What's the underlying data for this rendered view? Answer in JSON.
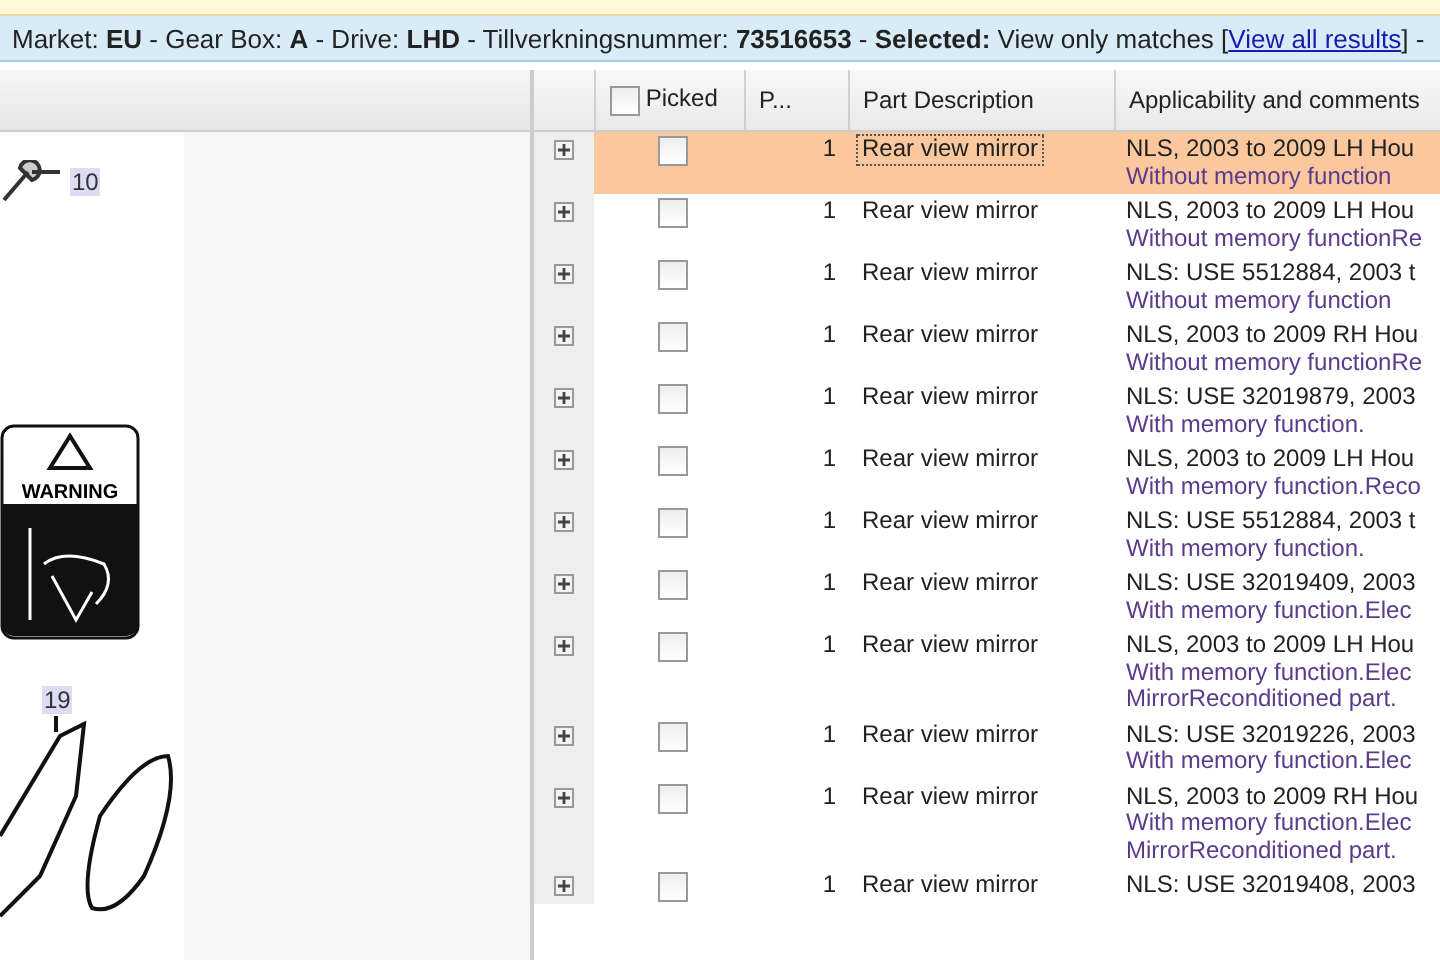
{
  "info_bar": {
    "text": "Market: **EU** - Gear Box: **A** - Drive: **LHD** - Tillverkningsnummer: **73516653** - **Selected:** View only matches [",
    "link": "View all results",
    "tail": "] -"
  },
  "diagram": {
    "callouts": [
      "10",
      "19"
    ],
    "warning_label": "WARNING"
  },
  "table": {
    "header_checkbox": {
      "checked": false
    },
    "columns": [
      "Picked",
      "P...",
      "Part Description",
      "Applicability and comments"
    ],
    "rows": [
      {
        "selected": true,
        "expanded": false,
        "checked": false,
        "qty": "1",
        "description": "Rear view mirror",
        "comments": [
          "NLS, 2003 to 2009 LH Hou",
          "Without memory function"
        ]
      },
      {
        "selected": false,
        "expanded": false,
        "checked": false,
        "qty": "1",
        "description": "Rear view mirror",
        "comments": [
          "NLS, 2003 to 2009 LH Hou",
          "Without memory functionRe"
        ]
      },
      {
        "selected": false,
        "expanded": false,
        "checked": false,
        "qty": "1",
        "description": "Rear view mirror",
        "comments": [
          "NLS: USE 5512884, 2003 t",
          "Without memory function"
        ]
      },
      {
        "selected": false,
        "expanded": false,
        "checked": false,
        "qty": "1",
        "description": "Rear view mirror",
        "comments": [
          "NLS, 2003 to 2009 RH Hou",
          "Without memory functionRe"
        ]
      },
      {
        "selected": false,
        "expanded": false,
        "checked": false,
        "qty": "1",
        "description": "Rear view mirror",
        "comments": [
          "NLS: USE 32019879, 2003",
          "With memory function."
        ]
      },
      {
        "selected": false,
        "expanded": false,
        "checked": false,
        "qty": "1",
        "description": "Rear view mirror",
        "comments": [
          "NLS, 2003 to 2009 LH Hou",
          "With memory function.Reco"
        ]
      },
      {
        "selected": false,
        "expanded": false,
        "checked": false,
        "qty": "1",
        "description": "Rear view mirror",
        "comments": [
          "NLS: USE 5512884, 2003 t",
          "With memory function."
        ]
      },
      {
        "selected": false,
        "expanded": false,
        "checked": false,
        "qty": "1",
        "description": "Rear view mirror",
        "comments": [
          "NLS: USE 32019409, 2003",
          "With memory function.Elec"
        ]
      },
      {
        "selected": false,
        "expanded": false,
        "checked": false,
        "qty": "1",
        "description": "Rear view mirror",
        "comments": [
          "NLS, 2003 to 2009 LH Hou",
          "With memory function.Elec",
          "MirrorReconditioned part."
        ]
      },
      {
        "selected": false,
        "expanded": false,
        "checked": false,
        "qty": "1",
        "description": "Rear view mirror",
        "comments": [
          "NLS: USE 32019226, 2003",
          "With memory function.Elec"
        ]
      },
      {
        "selected": false,
        "expanded": false,
        "checked": false,
        "qty": "1",
        "description": "Rear view mirror",
        "comments": [
          "NLS, 2003 to 2009 RH Hou",
          "With memory function.Elec",
          "MirrorReconditioned part."
        ]
      },
      {
        "selected": false,
        "expanded": false,
        "checked": false,
        "qty": "1",
        "description": "Rear view mirror",
        "comments": [
          "NLS: USE 32019408, 2003"
        ]
      }
    ]
  }
}
